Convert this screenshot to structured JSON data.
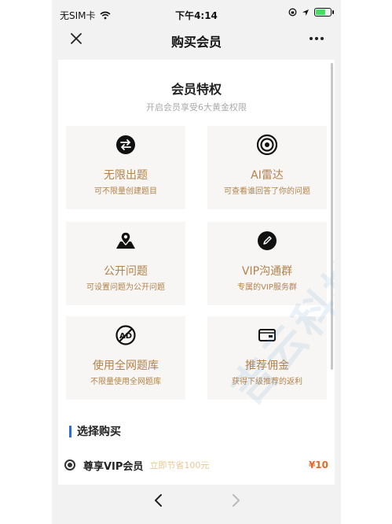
{
  "status_bar": {
    "carrier": "无SIM卡",
    "time": "下午4:14",
    "battery_level": 0.7
  },
  "nav": {
    "title": "购买会员"
  },
  "privileges": {
    "title": "会员特权",
    "subtitle": "开启会员享受6大黄金权限",
    "items": [
      {
        "icon": "swap-arrows-icon",
        "title": "无限出题",
        "desc": "可不限量创建题目"
      },
      {
        "icon": "target-icon",
        "title": "AI雷达",
        "desc": "可查看谁回答了你的问题"
      },
      {
        "icon": "map-pin-icon",
        "title": "公开问题",
        "desc": "可设置问题为公开问题"
      },
      {
        "icon": "pencil-icon",
        "title": "VIP沟通群",
        "desc": "专属的VIP服务群"
      },
      {
        "icon": "no-ads-icon",
        "title": "使用全网题库",
        "desc": "不限量使用全网题库"
      },
      {
        "icon": "card-icon",
        "title": "推荐佣金",
        "desc": "获得下级推荐的返利"
      }
    ]
  },
  "purchase": {
    "title": "选择购买",
    "option": {
      "name": "尊享VIP会员",
      "note": "立即节省100元",
      "price": "¥10"
    }
  },
  "colors": {
    "accent": "#b5824a",
    "price": "#e06a2a",
    "section_bar": "#2d6fd6"
  }
}
